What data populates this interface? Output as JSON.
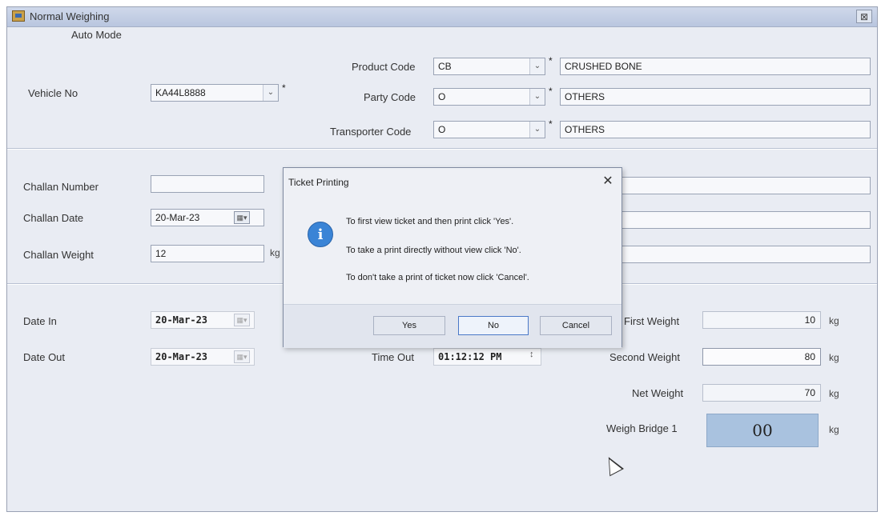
{
  "window": {
    "title": "Normal Weighing",
    "close": "⊠"
  },
  "mode_label": "Auto Mode",
  "vehicle": {
    "label": "Vehicle No",
    "value": "KA44L8888"
  },
  "product": {
    "label": "Product Code",
    "code": "CB",
    "desc": "CRUSHED BONE"
  },
  "party": {
    "label": "Party Code",
    "code": "O",
    "desc": "OTHERS"
  },
  "transporter": {
    "label": "Transporter Code",
    "code": "O",
    "desc": "OTHERS"
  },
  "challan": {
    "number_label": "Challan Number",
    "date_label": "Challan Date",
    "date_value": "20-Mar-23",
    "weight_label": "Challan Weight",
    "weight_value": "12",
    "weight_unit": "kg"
  },
  "dates": {
    "in_label": "Date In",
    "in_value": "20-Mar-23",
    "out_label": "Date Out",
    "out_value": "20-Mar-23",
    "time_out_label": "Time Out",
    "time_out_value": "01:12:12 PM"
  },
  "weights": {
    "first_label": "First Weight",
    "first_value": "10",
    "second_label": "Second Weight",
    "second_value": "80",
    "net_label": "Net Weight",
    "net_value": "70",
    "bridge_label": "Weigh Bridge 1",
    "bridge_value": "00",
    "unit": "kg"
  },
  "dialog": {
    "title": "Ticket Printing",
    "close": "✕",
    "line1": "To first view ticket and then print click 'Yes'.",
    "line2": "To take a print directly without view click 'No'.",
    "line3": "To don't take a print of ticket now click 'Cancel'.",
    "yes": "Yes",
    "no": "No",
    "cancel": "Cancel",
    "icon": "i"
  },
  "required_mark": "*"
}
